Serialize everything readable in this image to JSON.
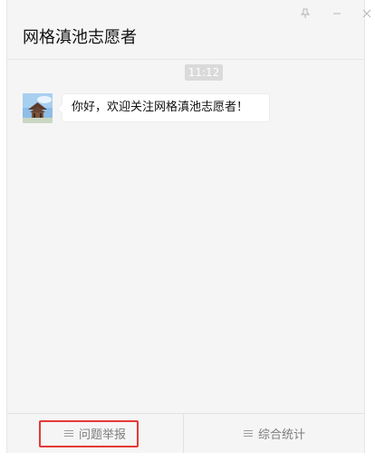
{
  "window": {
    "title": "网格滇池志愿者",
    "controls": {
      "pin": "pin-icon",
      "minimize": "minimize-icon",
      "close": "close-icon"
    }
  },
  "chat": {
    "time": "11:12",
    "messages": [
      {
        "avatar": "pavilion-avatar",
        "text": "你好，欢迎关注网格滇池志愿者！"
      }
    ]
  },
  "menu": {
    "items": [
      {
        "label": "问题举报",
        "icon": "menu-icon"
      },
      {
        "label": "综合统计",
        "icon": "menu-icon"
      }
    ]
  },
  "colors": {
    "background": "#f5f5f5",
    "bubble": "#ffffff",
    "time_badge": "#dadada",
    "highlight": "#e53935"
  }
}
